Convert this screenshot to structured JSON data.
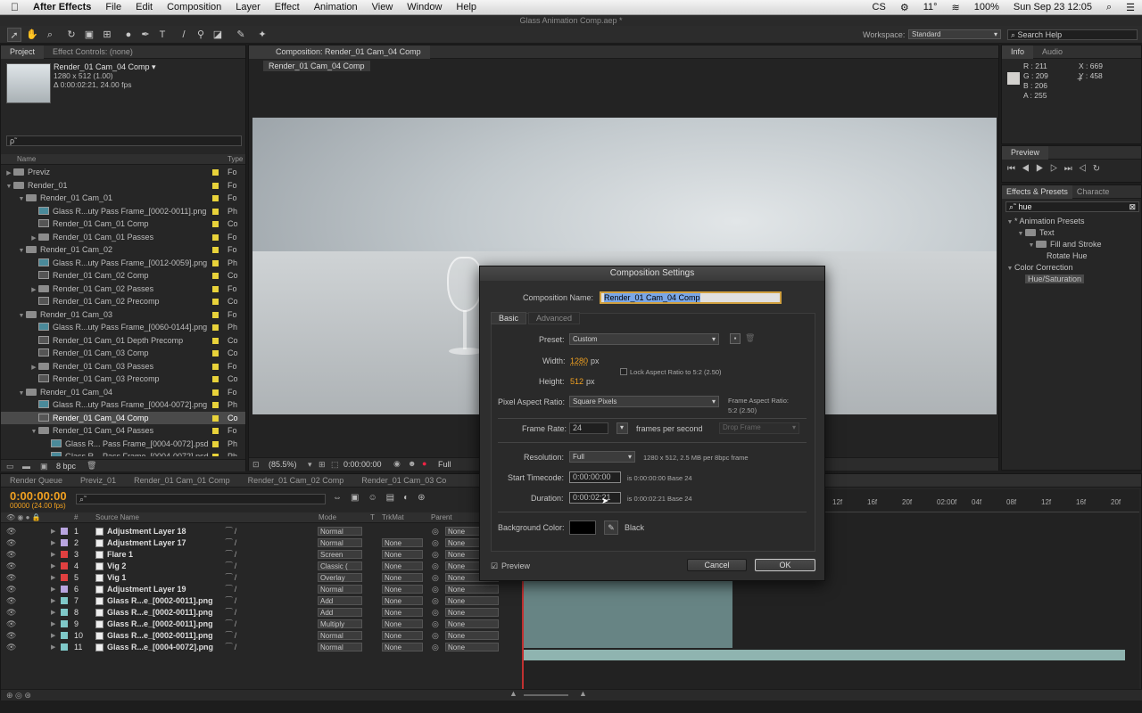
{
  "menubar": {
    "app": "After Effects",
    "items": [
      "File",
      "Edit",
      "Composition",
      "Layer",
      "Effect",
      "Animation",
      "View",
      "Window",
      "Help"
    ],
    "status": {
      "temp": "11°",
      "battery": "100%",
      "datetime": "Sun Sep 23  12:05"
    }
  },
  "window_title": "Glass Animation Comp.aep *",
  "toolbar": {
    "workspace_label": "Workspace:",
    "workspace_value": "Standard",
    "search_placeholder": "Search Help"
  },
  "project": {
    "tabs": [
      "Project",
      "Effect Controls: (none)"
    ],
    "selected_name": "Render_01 Cam_04 Comp ▾",
    "selected_size": "1280 x 512 (1.00)",
    "selected_duration": "Δ 0:00:02:21, 24.00 fps",
    "search_placeholder": "ρ˜",
    "col_name": "Name",
    "col_type": "Type",
    "bpc": "8 bpc",
    "items": [
      {
        "indent": 0,
        "kind": "folder",
        "tri": "▶",
        "name": "Previz",
        "type": "Fo"
      },
      {
        "indent": 0,
        "kind": "folder",
        "tri": "▼",
        "name": "Render_01",
        "type": "Fo"
      },
      {
        "indent": 1,
        "kind": "folder",
        "tri": "▼",
        "name": "Render_01 Cam_01",
        "type": "Fo"
      },
      {
        "indent": 2,
        "kind": "footage",
        "tri": "",
        "name": "Glass R...uty Pass Frame_[0002-0011].png",
        "type": "Ph"
      },
      {
        "indent": 2,
        "kind": "comp",
        "tri": "",
        "name": "Render_01 Cam_01 Comp",
        "type": "Co"
      },
      {
        "indent": 2,
        "kind": "folder",
        "tri": "▶",
        "name": "Render_01 Cam_01 Passes",
        "type": "Fo"
      },
      {
        "indent": 1,
        "kind": "folder",
        "tri": "▼",
        "name": "Render_01 Cam_02",
        "type": "Fo"
      },
      {
        "indent": 2,
        "kind": "footage",
        "tri": "",
        "name": "Glass R...uty Pass Frame_[0012-0059].png",
        "type": "Ph"
      },
      {
        "indent": 2,
        "kind": "comp",
        "tri": "",
        "name": "Render_01 Cam_02 Comp",
        "type": "Co"
      },
      {
        "indent": 2,
        "kind": "folder",
        "tri": "▶",
        "name": "Render_01 Cam_02 Passes",
        "type": "Fo"
      },
      {
        "indent": 2,
        "kind": "comp",
        "tri": "",
        "name": "Render_01 Cam_02 Precomp",
        "type": "Co"
      },
      {
        "indent": 1,
        "kind": "folder",
        "tri": "▼",
        "name": "Render_01 Cam_03",
        "type": "Fo"
      },
      {
        "indent": 2,
        "kind": "footage",
        "tri": "",
        "name": "Glass R...uty Pass Frame_[0060-0144].png",
        "type": "Ph"
      },
      {
        "indent": 2,
        "kind": "comp",
        "tri": "",
        "name": "Render_01 Cam_01 Depth Precomp",
        "type": "Co"
      },
      {
        "indent": 2,
        "kind": "comp",
        "tri": "",
        "name": "Render_01 Cam_03 Comp",
        "type": "Co"
      },
      {
        "indent": 2,
        "kind": "folder",
        "tri": "▶",
        "name": "Render_01 Cam_03 Passes",
        "type": "Fo"
      },
      {
        "indent": 2,
        "kind": "comp",
        "tri": "",
        "name": "Render_01 Cam_03 Precomp",
        "type": "Co"
      },
      {
        "indent": 1,
        "kind": "folder",
        "tri": "▼",
        "name": "Render_01 Cam_04",
        "type": "Fo"
      },
      {
        "indent": 2,
        "kind": "footage",
        "tri": "",
        "name": "Glass R...uty Pass Frame_[0004-0072].png",
        "type": "Ph"
      },
      {
        "indent": 2,
        "kind": "comp",
        "tri": "",
        "name": "Render_01 Cam_04 Comp",
        "type": "Co",
        "selected": true
      },
      {
        "indent": 2,
        "kind": "folder",
        "tri": "▼",
        "name": "Render_01 Cam_04 Passes",
        "type": "Fo"
      },
      {
        "indent": 3,
        "kind": "footage",
        "tri": "",
        "name": "Glass R... Pass Frame_[0004-0072].psd",
        "type": "Ph"
      },
      {
        "indent": 3,
        "kind": "footage",
        "tri": "",
        "name": "Glass R... Pass Frame_[0004-0072].psd",
        "type": "Ph"
      }
    ]
  },
  "comp_viewer": {
    "tab": "Composition: Render_01 Cam_04 Comp",
    "subtab": "Render_01 Cam_04 Comp",
    "zoom": "(85.5%)",
    "timecode": "0:00:00:00",
    "resolution": "Full"
  },
  "info_panel": {
    "tabs": [
      "Info",
      "Audio"
    ],
    "r": "R : 211",
    "g": "G : 209",
    "b": "B : 206",
    "a": "A : 255",
    "x": "X : 669",
    "y": "Y : 458"
  },
  "preview_panel": {
    "tab": "Preview"
  },
  "effects_panel": {
    "tabs": [
      "Effects & Presets",
      "Characte"
    ],
    "search": "hue",
    "tree": [
      {
        "indent": 0,
        "tri": "▼",
        "text": "* Animation Presets",
        "folder": false
      },
      {
        "indent": 1,
        "tri": "▼",
        "text": "Text",
        "folder": true
      },
      {
        "indent": 2,
        "tri": "▼",
        "text": "Fill and Stroke",
        "folder": true
      },
      {
        "indent": 3,
        "tri": "",
        "text": "Rotate Hue",
        "folder": false
      },
      {
        "indent": 0,
        "tri": "▼",
        "text": "Color Correction",
        "folder": false
      },
      {
        "indent": 1,
        "tri": "",
        "text": "Hue/Saturation",
        "folder": false,
        "selected": true
      }
    ]
  },
  "timeline": {
    "tabs": [
      "Render Queue",
      "Previz_01",
      "Render_01 Cam_01 Comp",
      "Render_01 Cam_02 Comp",
      "Render_01 Cam_03 Co"
    ],
    "timecode": "0:00:00:00",
    "fps": "00000 (24.00 fps)",
    "col_source": "Source Name",
    "col_mode": "Mode",
    "col_t": "T",
    "col_trkmat": "TrkMat",
    "col_parent": "Parent",
    "ruler": [
      "12f",
      "16f",
      "20f",
      "02:00f",
      "04f",
      "08f",
      "12f",
      "16f",
      "20f"
    ],
    "layers": [
      {
        "num": "1",
        "name": "Adjustment Layer 18",
        "color": "#b9a5e0",
        "mode": "Normal",
        "trkmat": "",
        "parent": "None"
      },
      {
        "num": "2",
        "name": "Adjustment Layer 17",
        "color": "#b9a5e0",
        "mode": "Normal",
        "trkmat": "None",
        "parent": "None"
      },
      {
        "num": "3",
        "name": "Flare 1",
        "color": "#e04040",
        "mode": "Screen",
        "trkmat": "None",
        "parent": "None"
      },
      {
        "num": "4",
        "name": "Vig 2",
        "color": "#e04040",
        "mode": "Classic (",
        "trkmat": "None",
        "parent": "None"
      },
      {
        "num": "5",
        "name": "Vig 1",
        "color": "#e04040",
        "mode": "Overlay",
        "trkmat": "None",
        "parent": "None"
      },
      {
        "num": "6",
        "name": "Adjustment Layer 19",
        "color": "#b9a5e0",
        "mode": "Normal",
        "trkmat": "None",
        "parent": "None"
      },
      {
        "num": "7",
        "name": "Glass R...e_[0002-0011].png",
        "color": "#7fc8c8",
        "mode": "Add",
        "trkmat": "None",
        "parent": "None"
      },
      {
        "num": "8",
        "name": "Glass R...e_[0002-0011].png",
        "color": "#7fc8c8",
        "mode": "Add",
        "trkmat": "None",
        "parent": "None"
      },
      {
        "num": "9",
        "name": "Glass R...e_[0002-0011].png",
        "color": "#7fc8c8",
        "mode": "Multiply",
        "trkmat": "None",
        "parent": "None"
      },
      {
        "num": "10",
        "name": "Glass R...e_[0002-0011].png",
        "color": "#7fc8c8",
        "mode": "Normal",
        "trkmat": "None",
        "parent": "None"
      },
      {
        "num": "11",
        "name": "Glass R...e_[0004-0072].png",
        "color": "#7fc8c8",
        "mode": "Normal",
        "trkmat": "None",
        "parent": "None"
      }
    ]
  },
  "dialog": {
    "title": "Composition Settings",
    "name_label": "Composition Name:",
    "name_value": "Render_01 Cam_04 Comp",
    "tabs": [
      "Basic",
      "Advanced"
    ],
    "preset_label": "Preset:",
    "preset_value": "Custom",
    "width_label": "Width:",
    "width_value": "1280",
    "height_label": "Height:",
    "height_value": "512",
    "px": "px",
    "lock_label": "Lock Aspect Ratio to 5:2 (2.50)",
    "par_label": "Pixel Aspect Ratio:",
    "par_value": "Square Pixels",
    "far_label": "Frame Aspect Ratio:",
    "far_value": "5:2 (2.50)",
    "fr_label": "Frame Rate:",
    "fr_value": "24",
    "fps_label": "frames per second",
    "drop_frame": "Drop Frame",
    "res_label": "Resolution:",
    "res_value": "Full",
    "res_info": "1280 x 512, 2.5 MB per 8bpc frame",
    "start_label": "Start Timecode:",
    "start_value": "0:00:00:00",
    "start_info": "is 0:00:00:00  Base 24",
    "dur_label": "Duration:",
    "dur_value": "0:00:02:21",
    "dur_info": "is 0:00:02:21  Base 24",
    "bg_label": "Background Color:",
    "bg_name": "Black",
    "bg_color": "#000000",
    "preview_label": "Preview",
    "cancel": "Cancel",
    "ok": "OK"
  },
  "colors": {
    "accent_orange": "#f0a020",
    "label_yellow": "#e8d23a",
    "selection": "#4a4a4a"
  }
}
